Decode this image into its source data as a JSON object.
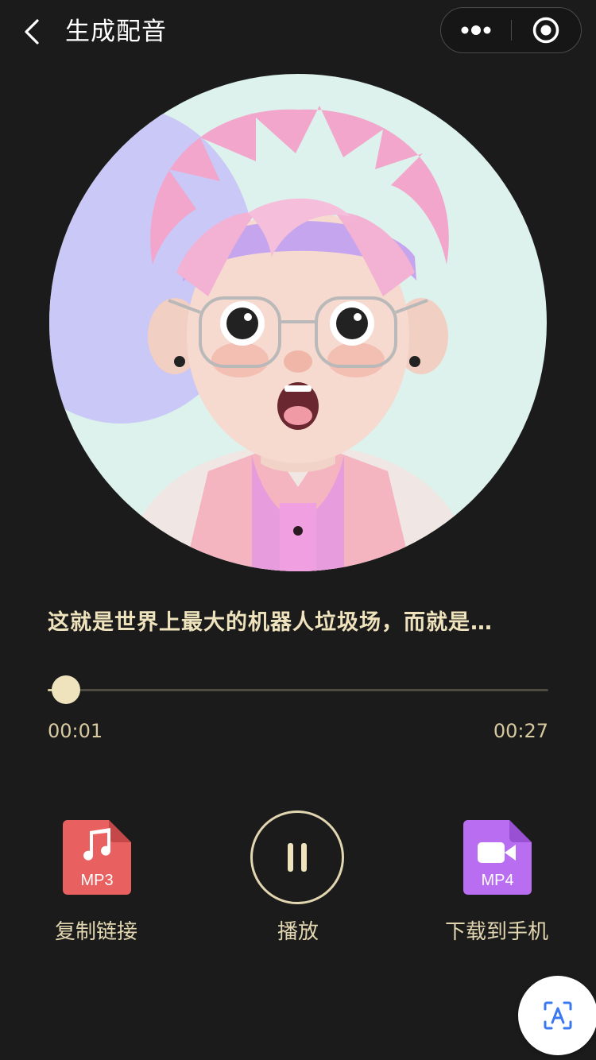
{
  "header": {
    "title": "生成配音",
    "back_icon": "chevron-left-icon",
    "more_icon": "more-dots-icon",
    "close_icon": "target-circle-icon"
  },
  "avatar": {
    "description_icon": "cartoon-avatar-image",
    "background_color": "#ddf2ec",
    "accent_color": "#c9c8f7"
  },
  "player": {
    "subtitle": "这就是世界上最大的机器人垃圾场，而就是…",
    "current_time": "00:01",
    "total_time": "00:27",
    "progress_fraction": 0.037
  },
  "actions": {
    "mp3": {
      "label": "复制链接",
      "file_type": "MP3",
      "icon": "mp3-file-icon",
      "color": "#e8605f"
    },
    "play": {
      "label": "播放",
      "icon": "pause-icon"
    },
    "mp4": {
      "label": "下载到手机",
      "file_type": "MP4",
      "icon": "mp4-file-icon",
      "color": "#b96ef1"
    }
  },
  "floating": {
    "icon": "translate-icon"
  },
  "colors": {
    "background": "#1b1b1b",
    "accent_text": "#efe3bd"
  }
}
